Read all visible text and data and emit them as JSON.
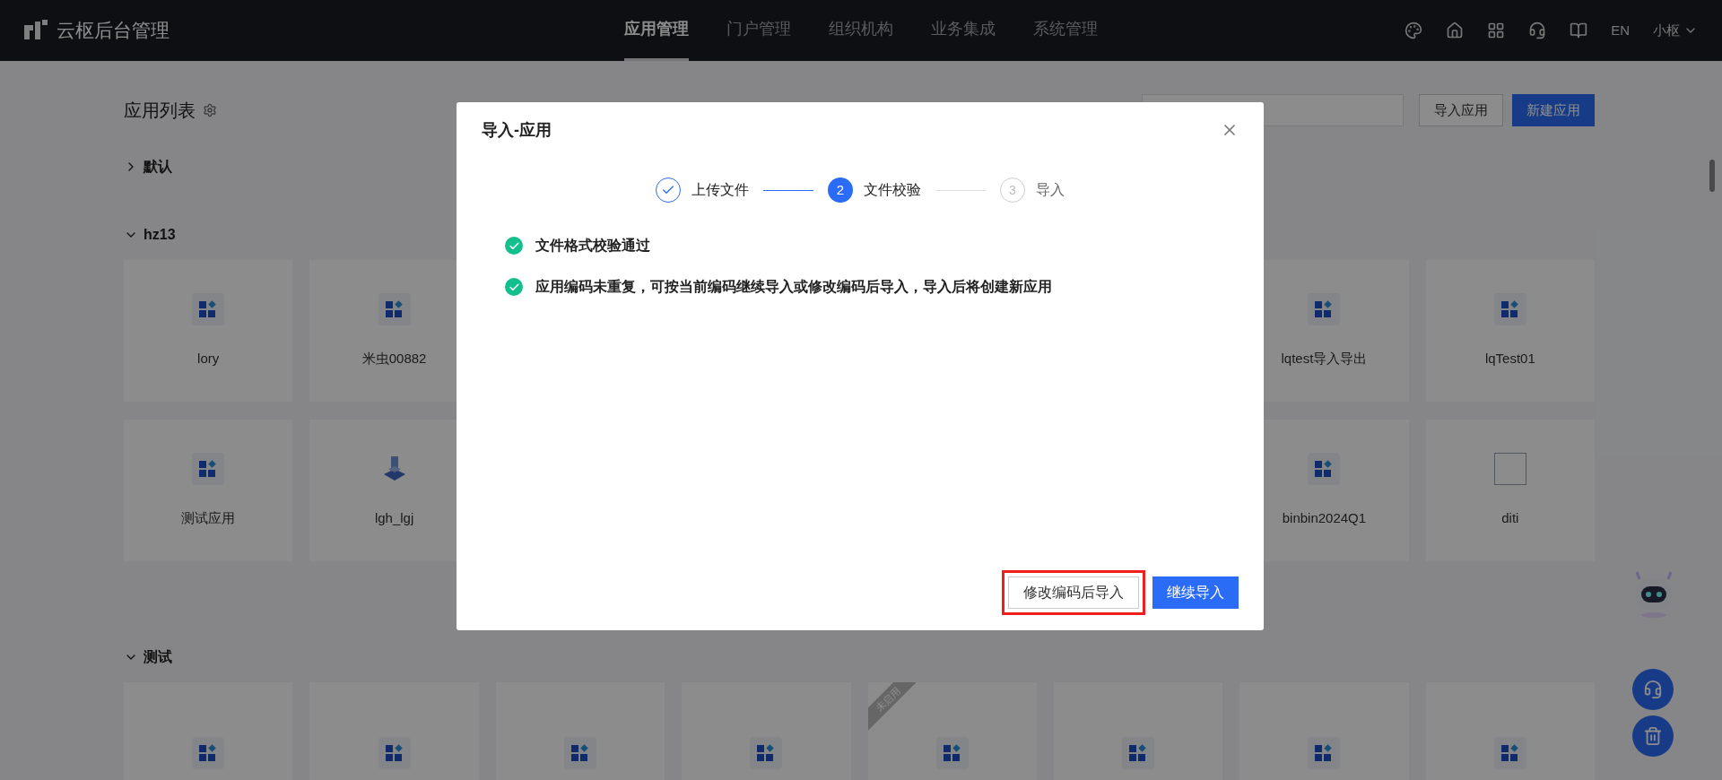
{
  "header": {
    "title": "云枢后台管理",
    "nav": [
      {
        "label": "应用管理",
        "selected": true
      },
      {
        "label": "门户管理",
        "selected": false
      },
      {
        "label": "组织机构",
        "selected": false
      },
      {
        "label": "业务集成",
        "selected": false
      },
      {
        "label": "系统管理",
        "selected": false
      }
    ],
    "language": "EN",
    "user": "小枢"
  },
  "page": {
    "title": "应用列表",
    "buttons": [
      {
        "label": "导入应用",
        "kind": "default"
      },
      {
        "label": "新建应用",
        "kind": "primary"
      }
    ],
    "groups": [
      {
        "name": "默认",
        "expanded": false
      },
      {
        "name": "hz13",
        "expanded": true,
        "rows": [
          {
            "lead": [
              {
                "label": "lory",
                "kind": "grid"
              },
              {
                "label": "米虫00882",
                "kind": "grid"
              }
            ],
            "tail": [
              {
                "label": "lqtest导入导出",
                "kind": "grid"
              },
              {
                "label": "lqTest01",
                "kind": "grid"
              }
            ]
          },
          {
            "lead": [
              {
                "label": "测试应用",
                "kind": "grid"
              },
              {
                "label": "lgh_lgj",
                "kind": "figure"
              }
            ],
            "tail": [
              {
                "label": "binbin2024Q1",
                "kind": "grid"
              },
              {
                "label": "diti",
                "kind": "broken"
              }
            ]
          }
        ]
      },
      {
        "name": "测试",
        "expanded": true,
        "rows": [
          {
            "lead": [
              {
                "kind": "grid"
              },
              {
                "kind": "grid"
              },
              {
                "kind": "grid"
              },
              {
                "kind": "grid"
              },
              {
                "kind": "grid",
                "ribbon": "未启用"
              },
              {
                "kind": "grid"
              },
              {
                "kind": "grid"
              },
              {
                "kind": "grid"
              }
            ],
            "tail": []
          }
        ]
      }
    ]
  },
  "dialog": {
    "title": "导入-应用",
    "steps": [
      {
        "label": "上传文件",
        "kind": "done"
      },
      {
        "number": "2",
        "label": "文件校验",
        "kind": "active"
      },
      {
        "number": "3",
        "label": "导入",
        "kind": "pending"
      }
    ],
    "messages": [
      {
        "text": "文件格式校验通过",
        "passed": true
      },
      {
        "text": "应用编码未重复，可按当前编码继续导入或修改编码后导入，导入后将创建新应用",
        "passed": true
      }
    ],
    "buttons": [
      {
        "label": "修改编码后导入",
        "kind": "default",
        "highlighted": true
      },
      {
        "label": "继续导入",
        "kind": "primary",
        "highlighted": false
      }
    ]
  }
}
